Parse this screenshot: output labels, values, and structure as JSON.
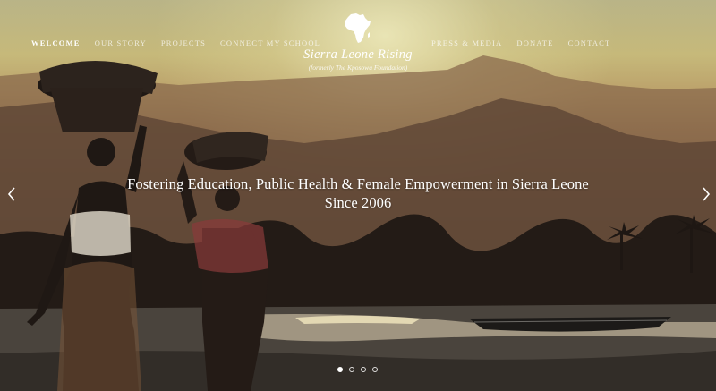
{
  "nav": {
    "left": [
      {
        "label": "Welcome",
        "active": true
      },
      {
        "label": "Our Story",
        "active": false
      },
      {
        "label": "Projects",
        "active": false
      },
      {
        "label": "Connect My School",
        "active": false
      }
    ],
    "right": [
      {
        "label": "Press & Media"
      },
      {
        "label": "Donate"
      },
      {
        "label": "Contact"
      }
    ]
  },
  "logo": {
    "icon": "africa-map-icon",
    "title": "Sierra Leone Rising",
    "subtitle": "(formerly The Kposowa Foundation)"
  },
  "hero": {
    "headline_line1": "Fostering Education, Public Health & Female Empowerment in Sierra Leone",
    "headline_line2": "Since 2006"
  },
  "slider": {
    "prev_icon": "chevron-left-icon",
    "next_icon": "chevron-right-icon",
    "slide_count": 4,
    "active_slide": 1
  },
  "colors": {
    "sky": "#c6b97a",
    "silhouette": "#2a201b",
    "text": "#ffffff"
  }
}
